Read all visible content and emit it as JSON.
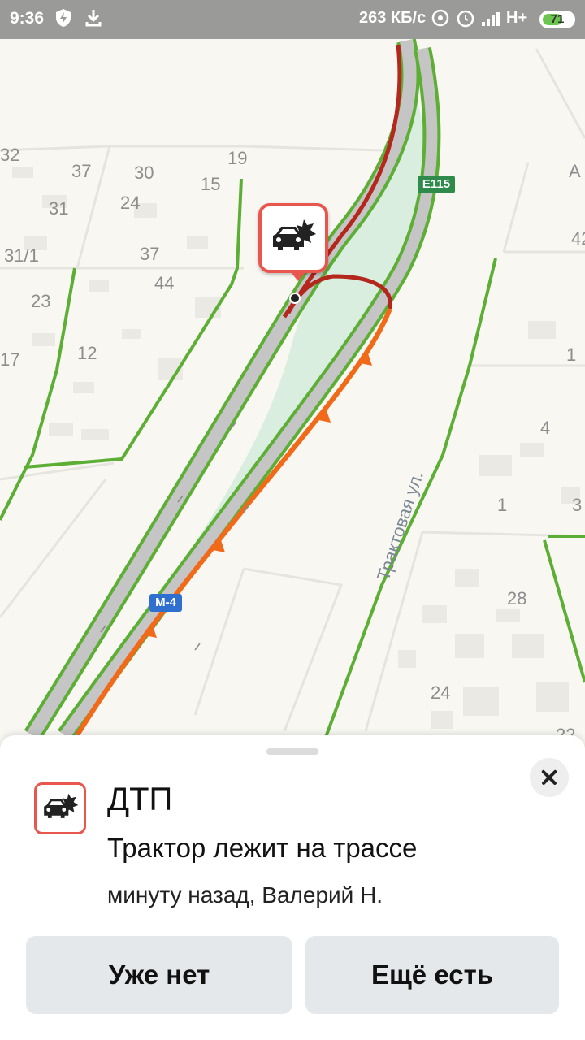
{
  "status_bar": {
    "time": "9:36",
    "speed": "263 КБ/с",
    "network": "H+",
    "battery": "71",
    "icons": [
      "shield-icon",
      "download-icon",
      "hotspot-icon",
      "alarm-icon",
      "signal-icon"
    ]
  },
  "map": {
    "road_badges": [
      {
        "id": "e115",
        "label": "E115",
        "color": "#2e8b4a"
      },
      {
        "id": "m4",
        "label": "M-4",
        "color": "#2f6fcf"
      }
    ],
    "street_label": "Трактовая ул.",
    "house_numbers": [
      "32",
      "37",
      "30",
      "19",
      "15",
      "24",
      "31",
      "31/1",
      "37",
      "44",
      "23",
      "12",
      "17",
      "1",
      "4",
      "1",
      "3",
      "28",
      "24",
      "22",
      "42",
      "А"
    ],
    "colors": {
      "traffic_dark_red": "#b4271c",
      "traffic_orange": "#f06a1a",
      "green_road": "#5cae35",
      "median": "#d9eedf"
    }
  },
  "incident": {
    "icon": "car-crash-icon",
    "title": "ДТП",
    "description": "Трактор лежит на трассе",
    "meta": "минуту назад, Валерий Н.",
    "buttons": {
      "no_longer": "Уже нет",
      "still_there": "Ещё есть"
    }
  }
}
